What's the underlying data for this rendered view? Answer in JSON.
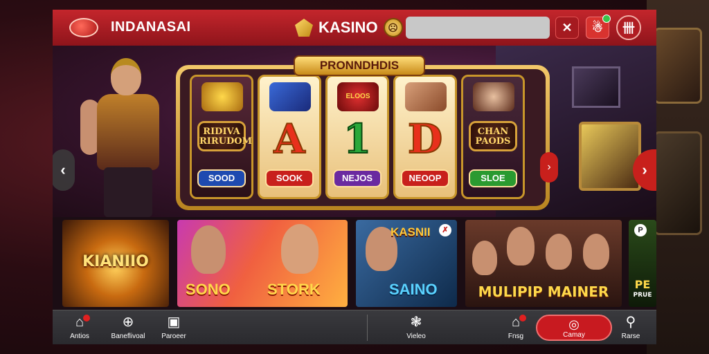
{
  "header": {
    "brand": "INDANASAI",
    "center_title": "KASINO",
    "coin_symbol": "☹",
    "search_placeholder": "",
    "close_label": "✕",
    "user_label": "☃",
    "menu_label": "卌"
  },
  "hero": {
    "slot_title": "PRONNDHDIS",
    "reels": [
      {
        "word": "RIDIVA RIRUDOM",
        "pill": "SOOD",
        "pill_color": "blue"
      },
      {
        "symbol": "A",
        "pill": "SOOK",
        "pill_color": "red"
      },
      {
        "symbol": "1",
        "top_text": "ELOOS",
        "pill": "NEJOS",
        "pill_color": "purple"
      },
      {
        "symbol": "D",
        "pill": "NEOOP",
        "pill_color": "red"
      },
      {
        "word": "CHAN PAODS",
        "pill": "SLOE",
        "pill_color": "green"
      }
    ],
    "footer_text": "....... .. . ...... . .. . ...",
    "prev_label": "‹",
    "next_label": "›",
    "mid_label": "›"
  },
  "tiles": [
    {
      "label": "KIANIIO"
    },
    {
      "label1": "SONO",
      "label2": "STORK"
    },
    {
      "label1": "KASNII",
      "label2": "SAINO",
      "badge": "✗"
    },
    {
      "label": "MULIPIP MAINER"
    },
    {
      "label": "PE",
      "sub": "PRUE",
      "badge": "P"
    }
  ],
  "bottom_nav": {
    "left": [
      {
        "icon": "⌂",
        "label": "Antios"
      },
      {
        "icon": "⊕",
        "label": "Baneflivoal"
      },
      {
        "icon": "▣",
        "label": "Paroeer"
      }
    ],
    "center": {
      "icon": "❃",
      "label": "Vieleo"
    },
    "right": {
      "icon": "⌂",
      "label": "Fnsg"
    },
    "cta": {
      "icon": "◎",
      "label": "Camay"
    },
    "last": {
      "icon": "⚲",
      "label": "Rarse"
    }
  },
  "colors": {
    "accent": "#c8201c",
    "gold": "#ffd84a"
  }
}
